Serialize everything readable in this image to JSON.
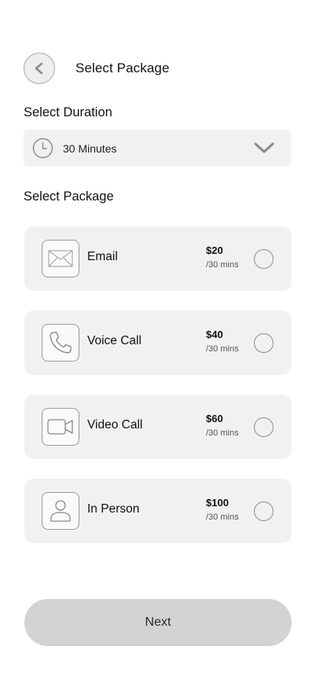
{
  "header": {
    "title": "Select Package",
    "back_icon": "chevron-left-icon"
  },
  "duration": {
    "label": "Select Duration",
    "selected": "30 Minutes",
    "icon": "clock-icon",
    "dropdown_icon": "chevron-down-icon"
  },
  "packages": {
    "label": "Select Package",
    "items": [
      {
        "name": "Email",
        "price": "$20",
        "unit": "/30 mins",
        "icon": "mail-icon",
        "selected": false
      },
      {
        "name": "Voice Call",
        "price": "$40",
        "unit": "/30 mins",
        "icon": "phone-icon",
        "selected": false
      },
      {
        "name": "Video Call",
        "price": "$60",
        "unit": "/30 mins",
        "icon": "video-camera-icon",
        "selected": false
      },
      {
        "name": "In Person",
        "price": "$100",
        "unit": "/30 mins",
        "icon": "person-icon",
        "selected": false
      }
    ]
  },
  "footer": {
    "next_label": "Next"
  },
  "colors": {
    "card_bg": "#f1f1f1",
    "button_bg": "#d3d3d3",
    "icon_stroke": "#8a8a8a"
  }
}
